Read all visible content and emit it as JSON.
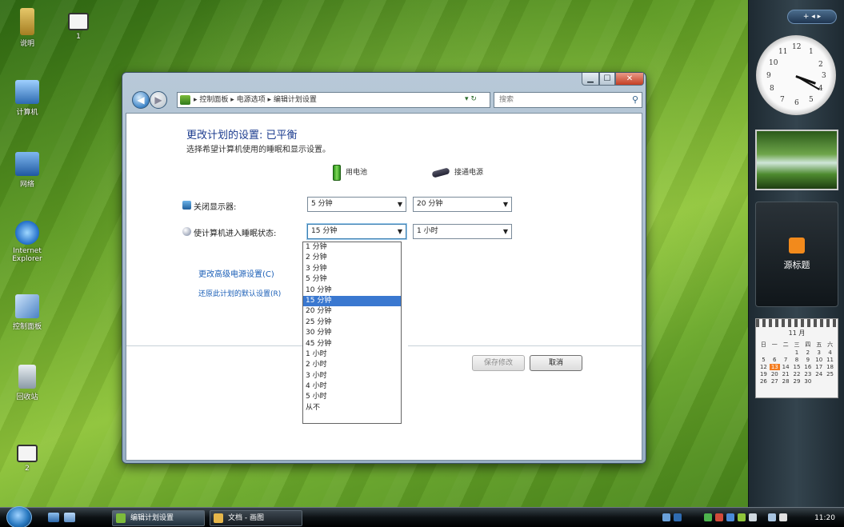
{
  "desktop_icons": [
    {
      "label": "说明",
      "color": "#c7a44a"
    },
    {
      "label": "1",
      "color": "#f0f0f0"
    },
    {
      "label": "计算机",
      "color": "#4f87c9"
    },
    {
      "label": "网络",
      "color": "#2f6bb0"
    },
    {
      "label": "Internet Explorer",
      "color": "#3a8ad8"
    },
    {
      "label": "控制面板",
      "color": "#6b9ad6"
    },
    {
      "label": "回收站",
      "color": "#a9b8c4"
    },
    {
      "label": "2",
      "color": "#f0f0f0"
    }
  ],
  "sidebar": {
    "toolbar_label": "+ ◂ ▸",
    "clock_numbers": [
      "12",
      "1",
      "2",
      "3",
      "4",
      "5",
      "6",
      "7",
      "8",
      "9",
      "10",
      "11"
    ],
    "rss_label": "源标题",
    "calendar": {
      "month_label": "11 月",
      "weekdays": [
        "日",
        "一",
        "二",
        "三",
        "四",
        "五",
        "六"
      ],
      "days": [
        "",
        "",
        "",
        "1",
        "2",
        "3",
        "4",
        "5",
        "6",
        "7",
        "8",
        "9",
        "10",
        "11",
        "12",
        "13",
        "14",
        "15",
        "16",
        "17",
        "18",
        "19",
        "20",
        "21",
        "22",
        "23",
        "24",
        "25",
        "26",
        "27",
        "28",
        "29",
        "30"
      ],
      "today": "13"
    }
  },
  "window": {
    "address_path": "▸ 控制面板 ▸ 电源选项 ▸ 编辑计划设置",
    "refresh_label": "▾ ↻",
    "search_placeholder": "搜索",
    "page_title": "更改计划的设置: 已平衡",
    "page_description": "选择希望计算机使用的睡眠和显示设置。",
    "col_battery": "用电池",
    "col_plugged": "接通电源",
    "row_display_label": "关闭显示器:",
    "row_sleep_label": "使计算机进入睡眠状态:",
    "display_battery_value": "5 分钟",
    "display_plugged_value": "20 分钟",
    "sleep_battery_value": "15 分钟",
    "sleep_plugged_value": "1 小时",
    "dropdown_options": [
      "1 分钟",
      "2 分钟",
      "3 分钟",
      "5 分钟",
      "10 分钟",
      "15 分钟",
      "20 分钟",
      "25 分钟",
      "30 分钟",
      "45 分钟",
      "1 小时",
      "2 小时",
      "3 小时",
      "4 小时",
      "5 小时",
      "从不"
    ],
    "dropdown_selected_index": 5,
    "link_advanced": "更改高级电源设置(C)",
    "link_restore": "还原此计划的默认设置(R)",
    "save_button": "保存修改",
    "cancel_button": "取消"
  },
  "taskbar": {
    "task1_label": "编辑计划设置",
    "task2_label": "文档 - 画图",
    "time": "11:20"
  }
}
